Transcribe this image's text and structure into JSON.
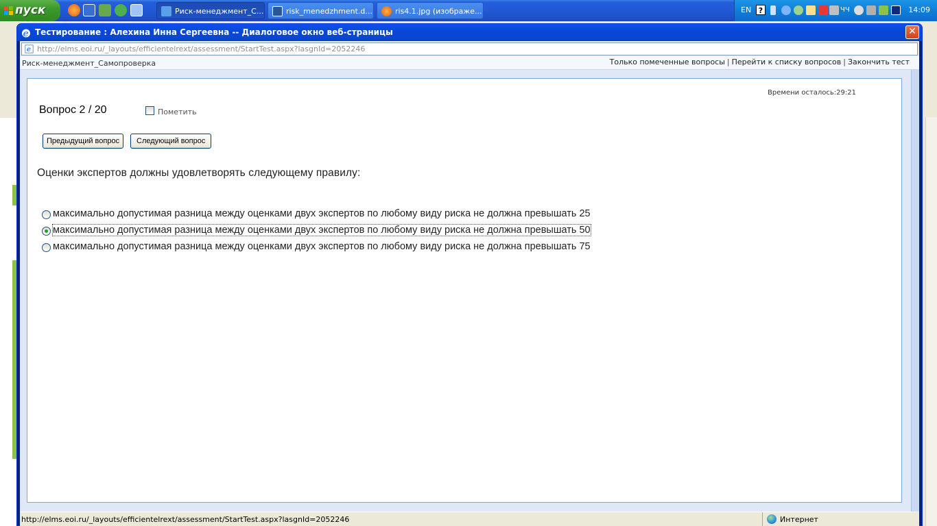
{
  "taskbar": {
    "start_label": "пуск",
    "tasks": [
      {
        "label": "Риск-менеджмент_С...",
        "active": true
      },
      {
        "label": "risk_menedzhment.d...",
        "active": false
      },
      {
        "label": "ris4.1.jpg (изображе...",
        "active": false
      }
    ],
    "language": "EN",
    "clock": "14:09"
  },
  "dialog": {
    "title": "Тестирование : Алехина Инна Сергеевна -- Диалоговое окно веб-страницы",
    "address": "http://elms.eoi.ru/_layouts/efficientelrext/assessment/StartTest.aspx?lasgnId=2052246"
  },
  "topbar": {
    "course": "Риск-менеджмент_Самопроверка",
    "links": [
      "Только помеченные вопросы",
      "Перейти к списку вопросов",
      "Закончить тест"
    ]
  },
  "test": {
    "timer": "Времени осталось:29:21",
    "question_number": "Вопрос 2 / 20",
    "mark_label": "Пометить",
    "prev_label": "Предыдущий вопрос",
    "next_label": "Следующий вопрос",
    "question_text": "Оценки экспертов должны удовлетворять следующему правилу:",
    "answers": [
      {
        "text": "максимально допустимая разница между оценками двух экспертов по любому виду риска не должна превышать 25",
        "selected": false
      },
      {
        "text": "максимально допустимая разница между оценками двух экспертов по любому виду риска не должна превышать 50",
        "selected": true
      },
      {
        "text": "максимально допустимая разница между оценками двух экспертов по любому виду риска не должна превышать 75",
        "selected": false
      }
    ]
  },
  "statusbar": {
    "url": "http://elms.eoi.ru/_layouts/efficientelrext/assessment/StartTest.aspx?lasgnId=2052246",
    "zone": "Интернет"
  },
  "colors": {
    "titlebar": "#0847d6",
    "panel_border": "#7ea6d9",
    "radio_check": "#21a121"
  }
}
